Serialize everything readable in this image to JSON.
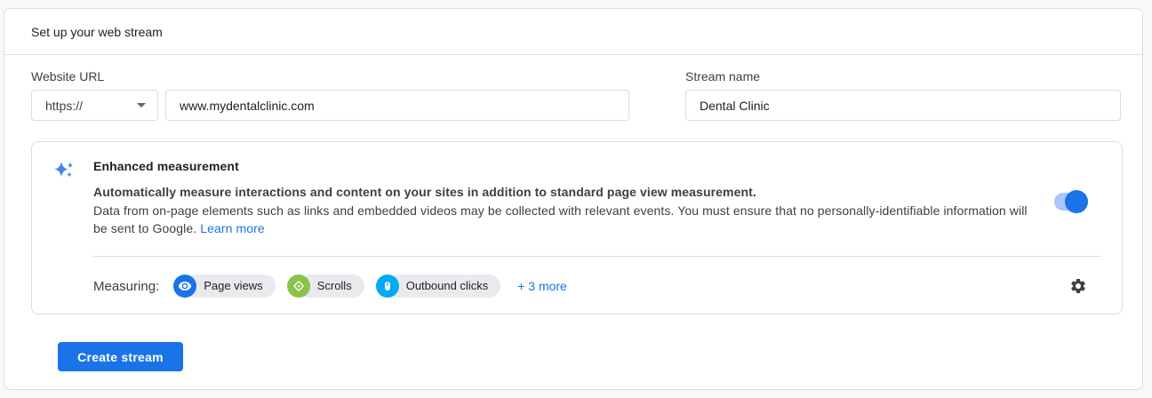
{
  "page": {
    "title": "Set up your web stream"
  },
  "form": {
    "website_url": {
      "label": "Website URL",
      "protocol_selected": "https://",
      "value": "www.mydentalclinic.com"
    },
    "stream_name": {
      "label": "Stream name",
      "value": "Dental Clinic"
    }
  },
  "enhanced_measurement": {
    "title": "Enhanced measurement",
    "description_line1": "Automatically measure interactions and content on your sites in addition to standard page view measurement.",
    "description_line2": "Data from on-page elements such as links and embedded videos may be collected with relevant events. You must ensure that no personally-identifiable information will be sent to Google.",
    "learn_more_label": "Learn more",
    "toggle_state": "on",
    "measuring_label": "Measuring:",
    "chips": [
      {
        "label": "Page views",
        "icon": "eye-icon",
        "color": "#1a73e8"
      },
      {
        "label": "Scrolls",
        "icon": "scroll-diamond-icon",
        "color": "#8bc34a"
      },
      {
        "label": "Outbound clicks",
        "icon": "mouse-icon",
        "color": "#03a9f4"
      }
    ],
    "more_link": "+ 3 more"
  },
  "actions": {
    "create_button": "Create stream"
  },
  "colors": {
    "accent": "#1a73e8",
    "toggle_track": "#a8c7fa",
    "toggle_thumb": "#1a73e8",
    "chip_background": "#e8eaed",
    "page_background": "#f8f9fa",
    "sparkle_icon": "#4285f4"
  }
}
